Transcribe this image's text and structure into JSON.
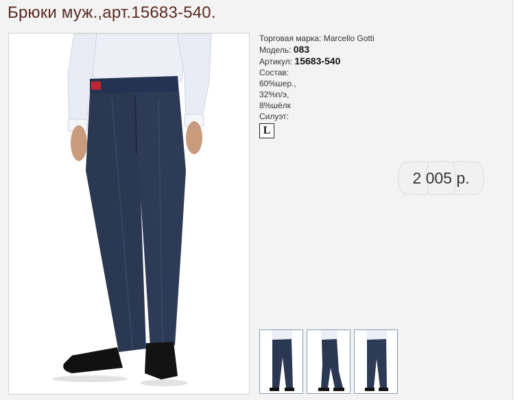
{
  "product": {
    "title": "Брюки муж.,арт.15683-540."
  },
  "details": {
    "brand_label": "Торговая марка:",
    "brand_value": "Marcello Gotti",
    "model_label": "Модель:",
    "model_value": "083",
    "article_label": "Артикул:",
    "article_value": "15683-540",
    "composition_label": "Состав:",
    "composition": [
      "60%шер.,",
      "32%п/э,",
      "8%шёлк"
    ],
    "silhouette_label": "Силуэт:",
    "silhouette_value": "L"
  },
  "price": {
    "text": "2 005 р."
  },
  "thumbnails": [
    {
      "view": "front"
    },
    {
      "view": "side"
    },
    {
      "view": "back"
    }
  ],
  "colors": {
    "title": "#5a2a22",
    "pants": "#2b3852",
    "shirt": "#eef0f6"
  }
}
